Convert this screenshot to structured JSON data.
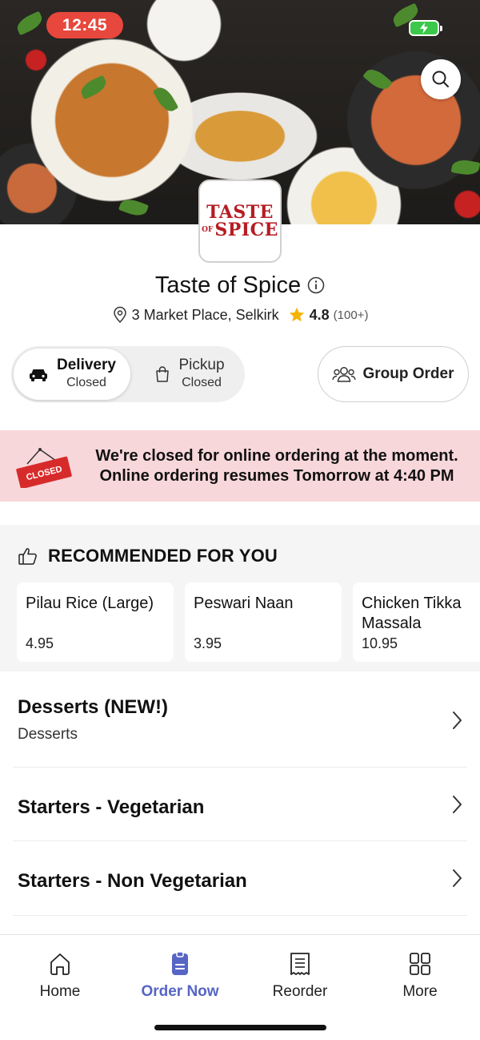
{
  "status_bar": {
    "time": "12:45"
  },
  "restaurant": {
    "logo_line1": "TASTE",
    "logo_of": "OF",
    "logo_line2": "SPICE",
    "name": "Taste of Spice",
    "address": "3 Market Place, Selkirk",
    "rating": "4.8",
    "rating_count": "(100+)"
  },
  "modes": {
    "delivery": {
      "label": "Delivery",
      "status": "Closed"
    },
    "pickup": {
      "label": "Pickup",
      "status": "Closed"
    },
    "group_order": "Group Order"
  },
  "closed_banner": {
    "sign": "CLOSED",
    "line1": "We're closed for online ordering at the moment.",
    "line2": "Online ordering resumes Tomorrow at 4:40 PM"
  },
  "recommended": {
    "title": "RECOMMENDED FOR YOU",
    "items": [
      {
        "name": "Pilau Rice (Large)",
        "price": "4.95"
      },
      {
        "name": "Peswari Naan",
        "price": "3.95"
      },
      {
        "name": "Chicken Tikka Massala",
        "price": "10.95"
      }
    ]
  },
  "categories": [
    {
      "title": "Desserts (NEW!)",
      "subtitle": "Desserts"
    },
    {
      "title": "Starters - Vegetarian",
      "subtitle": ""
    },
    {
      "title": "Starters - Non Vegetarian",
      "subtitle": ""
    }
  ],
  "nav": [
    {
      "label": "Home",
      "icon": "home-icon"
    },
    {
      "label": "Order Now",
      "icon": "order-icon",
      "active": true
    },
    {
      "label": "Reorder",
      "icon": "receipt-icon"
    },
    {
      "label": "More",
      "icon": "grid-icon"
    }
  ],
  "colors": {
    "status_time_bg": "#e8473d",
    "battery": "#3cc84a",
    "brand_red": "#b51d23",
    "closed_banner_bg": "#f8d7db",
    "star": "#f5b400",
    "nav_active": "#5765c4"
  }
}
